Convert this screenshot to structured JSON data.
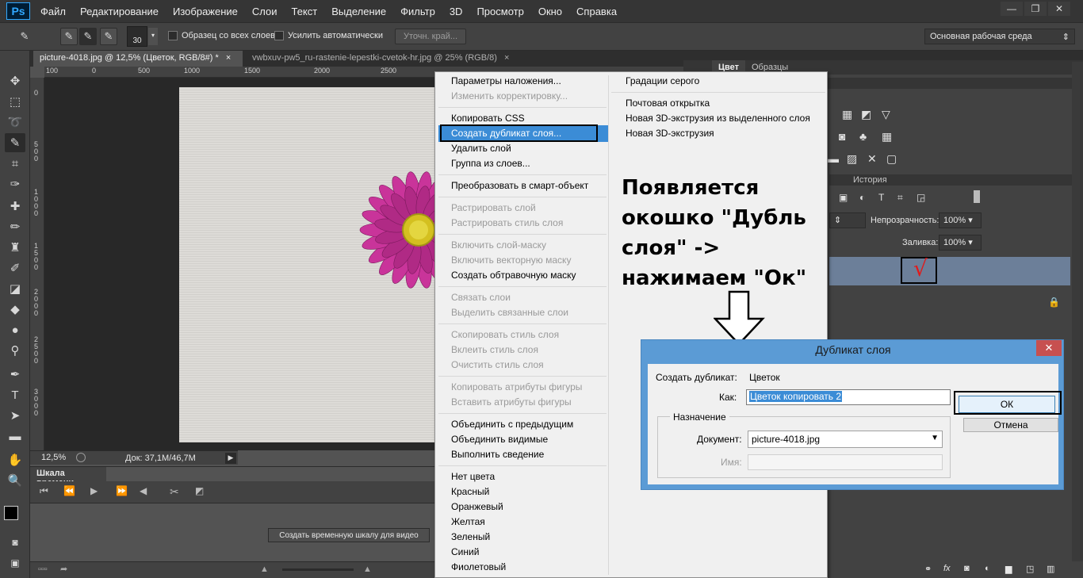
{
  "menubar": {
    "logo": "Ps",
    "items": [
      "Файл",
      "Редактирование",
      "Изображение",
      "Слои",
      "Текст",
      "Выделение",
      "Фильтр",
      "3D",
      "Просмотр",
      "Окно",
      "Справка"
    ]
  },
  "options": {
    "brush_size": "30",
    "sample_all_layers": "Образец со всех слоев",
    "auto_enhance": "Усилить автоматически",
    "refine_edge": "Уточн. край...",
    "workspace": "Основная рабочая среда"
  },
  "tabs": [
    {
      "label": "picture-4018.jpg @ 12,5% (Цветок, RGB/8#) *",
      "close": "×"
    },
    {
      "label": "vwbxuv-pw5_ru-rastenie-lepestki-cvetok-hr.jpg @ 25% (RGB/8)",
      "close": "×"
    }
  ],
  "ruler": {
    "top": [
      "100",
      "0",
      "500",
      "1000",
      "1500",
      "2000",
      "2500"
    ],
    "left": [
      "0",
      "5 0 0",
      "1 0 0 0",
      "1 5 0 0",
      "2 0 0 0",
      "2 5 0 0",
      "3 0 0 0"
    ]
  },
  "status": {
    "zoom": "12,5%",
    "doc": "Док: 37,1M/46,7M"
  },
  "timeline": {
    "title": "Шкала времени",
    "create_button": "Создать временную шкалу для видео"
  },
  "right_panel": {
    "tab_color": "Цвет",
    "tab_swatches": "Образцы",
    "tab_history": "История",
    "opacity_label": "Непрозрачность:",
    "opacity_value": "100%",
    "fill_label": "Заливка:",
    "fill_value": "100%",
    "checkmark": "√"
  },
  "context_menu": {
    "left": [
      {
        "label": "Параметры наложения...",
        "disabled": false
      },
      {
        "label": "Изменить корректировку...",
        "disabled": true
      },
      {
        "label": "Копировать CSS",
        "disabled": false
      },
      {
        "label": "Создать дубликат слоя...",
        "disabled": false,
        "highlighted": true
      },
      {
        "label": "Удалить слой",
        "disabled": false
      },
      {
        "label": "Группа из слоев...",
        "disabled": false
      },
      {
        "label": "Преобразовать в смарт-объект",
        "disabled": false
      },
      {
        "label": "Растрировать слой",
        "disabled": true
      },
      {
        "label": "Растрировать стиль слоя",
        "disabled": true
      },
      {
        "label": "Включить слой-маску",
        "disabled": true
      },
      {
        "label": "Включить векторную маску",
        "disabled": true
      },
      {
        "label": "Создать обтравочную маску",
        "disabled": false
      },
      {
        "label": "Связать слои",
        "disabled": true
      },
      {
        "label": "Выделить связанные слои",
        "disabled": true
      },
      {
        "label": "Скопировать стиль слоя",
        "disabled": true
      },
      {
        "label": "Вклеить стиль слоя",
        "disabled": true
      },
      {
        "label": "Очистить стиль слоя",
        "disabled": true
      },
      {
        "label": "Копировать атрибуты фигуры",
        "disabled": true
      },
      {
        "label": "Вставить атрибуты фигуры",
        "disabled": true
      },
      {
        "label": "Объединить с предыдущим",
        "disabled": false
      },
      {
        "label": "Объединить видимые",
        "disabled": false
      },
      {
        "label": "Выполнить сведение",
        "disabled": false
      },
      {
        "label": "Нет цвета",
        "disabled": false
      },
      {
        "label": "Красный",
        "disabled": false
      },
      {
        "label": "Оранжевый",
        "disabled": false
      },
      {
        "label": "Желтая",
        "disabled": false
      },
      {
        "label": "Зеленый",
        "disabled": false
      },
      {
        "label": "Синий",
        "disabled": false
      },
      {
        "label": "Фиолетовый",
        "disabled": false
      }
    ],
    "right": [
      {
        "label": "Градации серого",
        "disabled": false
      },
      {
        "label": "Почтовая открытка",
        "disabled": false
      },
      {
        "label": "Новая 3D-экструзия из выделенного слоя",
        "disabled": false
      },
      {
        "label": "Новая 3D-экструзия",
        "disabled": true
      }
    ]
  },
  "annotation": {
    "lines": [
      "Появляется",
      "окошко \"Дубль",
      "слоя\" ->",
      "нажимаем \"Ок\""
    ]
  },
  "dialog": {
    "title": "Дубликат слоя",
    "close": "✕",
    "duplicate_label": "Создать дубликат:",
    "duplicate_value": "Цветок",
    "as_label": "Как:",
    "as_value": "Цветок копировать 2",
    "destination_label": "Назначение",
    "document_label": "Документ:",
    "document_value": "picture-4018.jpg",
    "name_label": "Имя:",
    "ok": "ОК",
    "cancel": "Отмена"
  },
  "colors": {
    "menu_highlight": "#3b8cd6",
    "flower": "#c9349a",
    "flower_center": "#d4c020",
    "dialog_frame": "#5b9bd5"
  }
}
